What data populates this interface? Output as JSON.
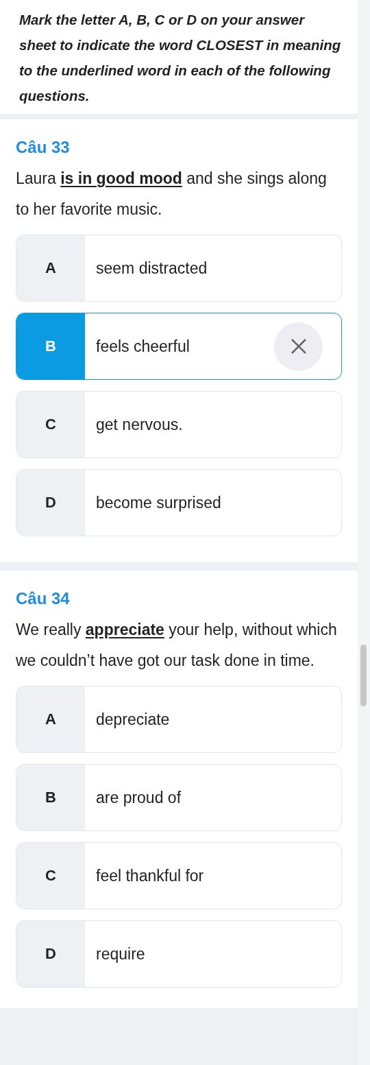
{
  "instruction": "Mark the letter A, B, C or D on your answer sheet to indicate the word CLOSEST in meaning to the underlined word in each of the following questions.",
  "questions": [
    {
      "title": "Câu 33",
      "text": "Laura **is in good mood** and she sings along to her favorite music.",
      "options": [
        {
          "letter": "A",
          "text": "seem distracted",
          "selected": false
        },
        {
          "letter": "B",
          "text": "feels cheerful",
          "selected": true
        },
        {
          "letter": "C",
          "text": "get nervous.",
          "selected": false
        },
        {
          "letter": "D",
          "text": "become surprised",
          "selected": false
        }
      ]
    },
    {
      "title": "Câu 34",
      "text": "We really **appreciate** your help, without which we couldn’t have got our task done in time.",
      "options": [
        {
          "letter": "A",
          "text": "depreciate",
          "selected": false
        },
        {
          "letter": "B",
          "text": "are proud of",
          "selected": false
        },
        {
          "letter": "C",
          "text": "feel thankful for",
          "selected": false
        },
        {
          "letter": "D",
          "text": "require",
          "selected": false
        }
      ]
    }
  ]
}
